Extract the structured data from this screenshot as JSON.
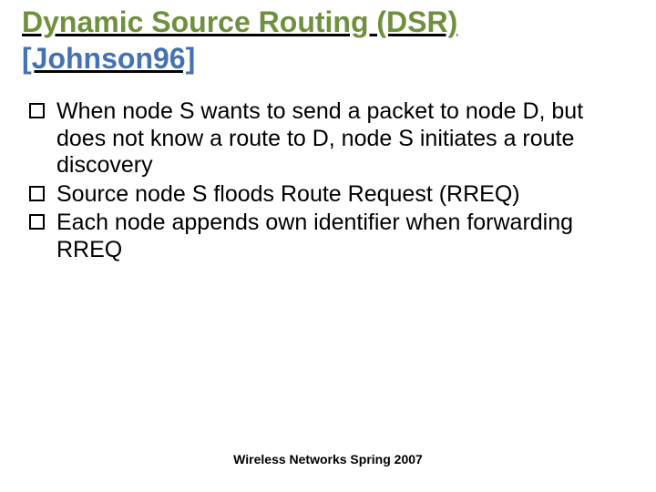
{
  "title": {
    "line1": "Dynamic Source Routing (DSR)",
    "line2": "[Johnson96]"
  },
  "bullets": {
    "items": [
      "When node S wants to send a packet to node D, but does not know a route to D, node S initiates a route discovery",
      "Source node S floods Route Request (RREQ)",
      "Each node appends own identifier when forwarding RREQ"
    ]
  },
  "footer": {
    "text": "Wireless Networks Spring 2007"
  }
}
